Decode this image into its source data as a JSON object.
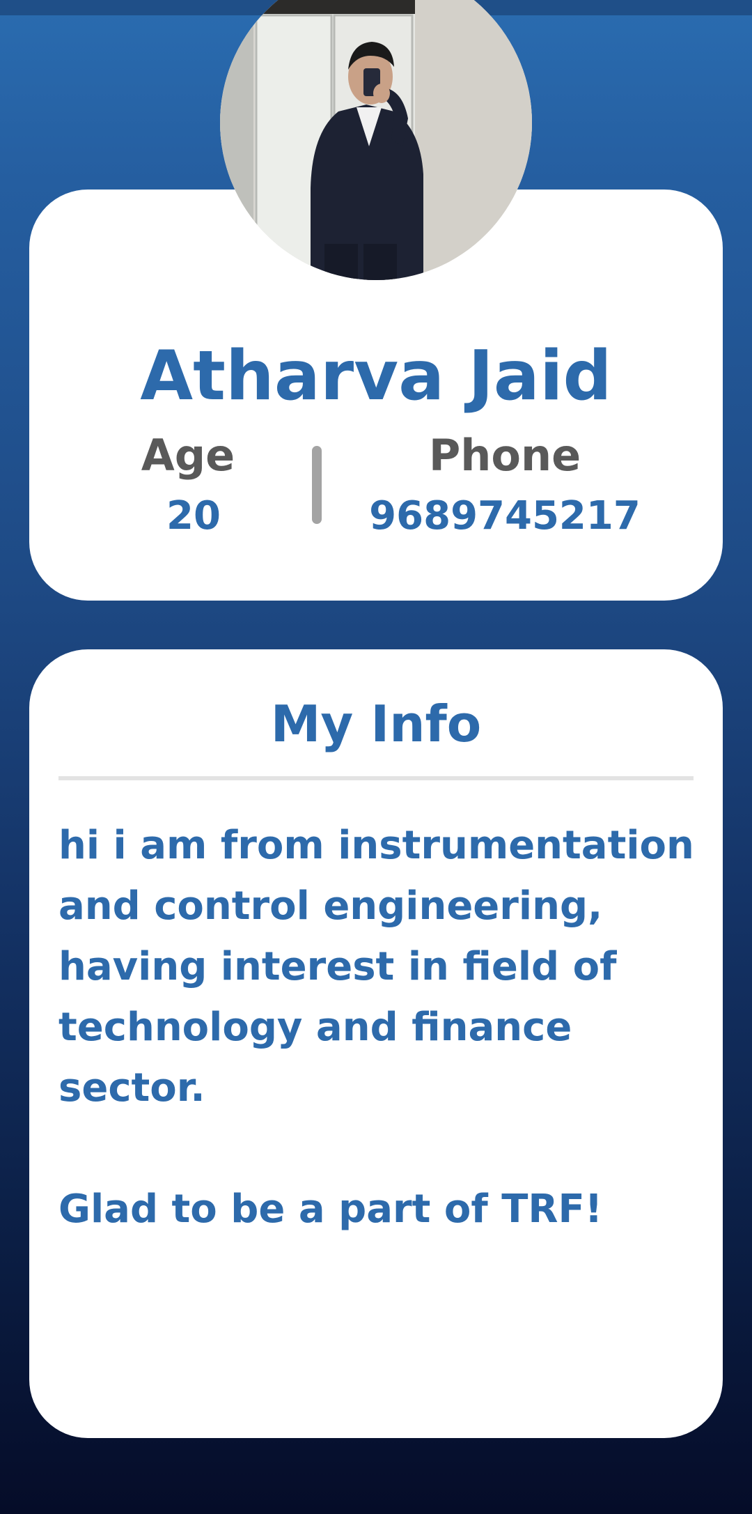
{
  "profile": {
    "avatar_icon": "profile-photo",
    "name": "Atharva Jaid",
    "age_label": "Age",
    "age_value": "20",
    "phone_label": "Phone",
    "phone_value": "9689745217"
  },
  "info": {
    "title": "My Info",
    "bio_lines": [
      "hi i am from instrumentation",
      "and control engineering,",
      "having interest in field of",
      "technology and finance sector."
    ],
    "closing": "Glad to be a part of TRF!"
  },
  "colors": {
    "accent": "#2d6aab",
    "label_gray": "#595959",
    "gradient_top": "#2a6cb0",
    "gradient_bottom": "#050c28"
  }
}
